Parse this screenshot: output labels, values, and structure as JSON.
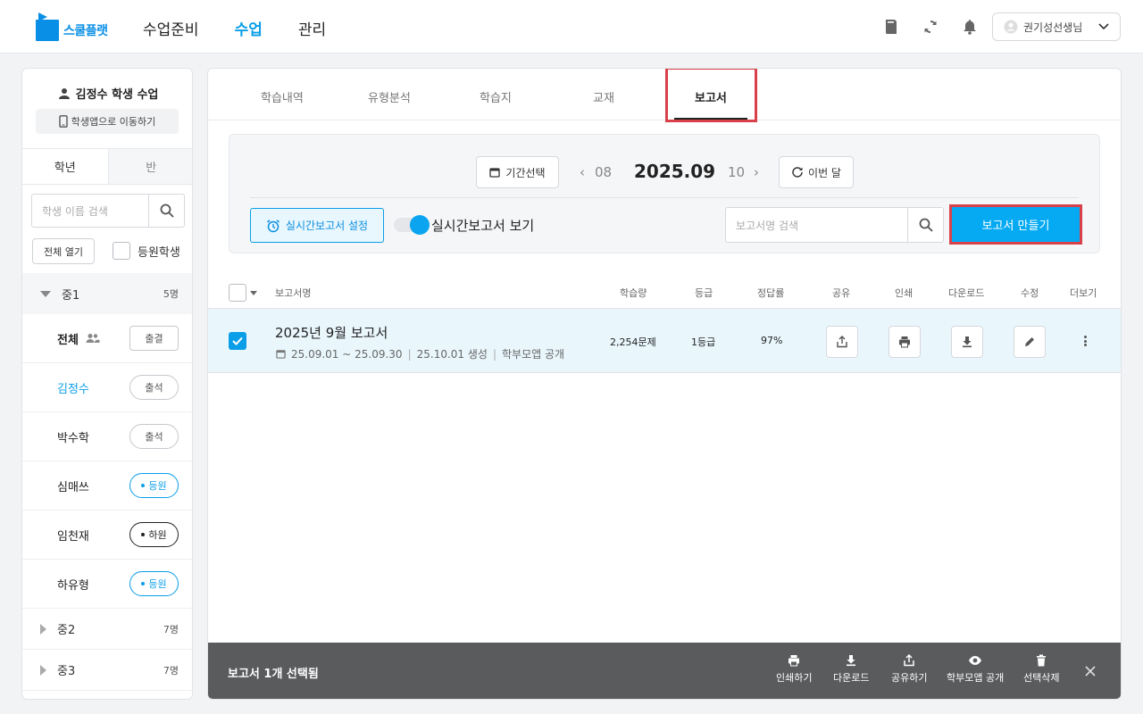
{
  "header": {
    "logo_text": "스쿨플랫",
    "nav": [
      "수업준비",
      "수업",
      "관리"
    ],
    "active_nav": "수업",
    "user_name": "권기성선생님",
    "icons": [
      "book-icon",
      "sync-icon",
      "bell-icon"
    ]
  },
  "sidebar": {
    "title": "김정수 학생 수업",
    "move_button": "학생앱으로 이동하기",
    "tabs": [
      "학년",
      "반"
    ],
    "search_placeholder": "학생 이름 검색",
    "open_all": "전체 열기",
    "enrolled_label": "등원학생",
    "grades": [
      {
        "name": "중1",
        "count": "5명",
        "expanded": true
      },
      {
        "name": "중2",
        "count": "7명",
        "expanded": false
      },
      {
        "name": "중3",
        "count": "7명",
        "expanded": false
      }
    ],
    "students": [
      {
        "name": "전체",
        "status": "출결"
      },
      {
        "name": "김정수",
        "status": "출석"
      },
      {
        "name": "박수학",
        "status": "출석"
      },
      {
        "name": "심매쓰",
        "status": "등원"
      },
      {
        "name": "임천재",
        "status": "하원"
      },
      {
        "name": "하유형",
        "status": "등원"
      }
    ]
  },
  "tabs": [
    "학습내역",
    "유형분석",
    "학습지",
    "교재",
    "보고서"
  ],
  "active_tab": "보고서",
  "filter": {
    "period_button": "기간선택",
    "prev_month": "08",
    "current_month": "2025.09",
    "next_month": "10",
    "this_month_button": "이번 달",
    "realtime_setting": "실시간보고서 설정",
    "realtime_view": "실시간보고서 보기",
    "realtime_view_on": true,
    "search_placeholder": "보고서명 검색",
    "make_button": "보고서 만들기"
  },
  "table": {
    "columns": [
      "보고서명",
      "학습량",
      "등급",
      "정답률",
      "공유",
      "인쇄",
      "다운로드",
      "수정",
      "더보기"
    ],
    "rows": [
      {
        "checked": true,
        "name": "2025년 9월 보고서",
        "period": "25.09.01 ~ 25.09.30",
        "created": "25.10.01 생성",
        "visibility": "학부모앱 공개",
        "volume": "2,254문제",
        "grade": "1등급",
        "accuracy": "97%"
      }
    ]
  },
  "action_bar": {
    "label": "보고서 1개 선택됨",
    "actions": [
      "인쇄하기",
      "다운로드",
      "공유하기",
      "학부모앱 공개",
      "선택삭제"
    ]
  },
  "colors": {
    "accent": "#0a9ee8",
    "primary_button": "#05aaf3",
    "highlight": "#d9414a",
    "action_bar": "#5a5b5d"
  }
}
